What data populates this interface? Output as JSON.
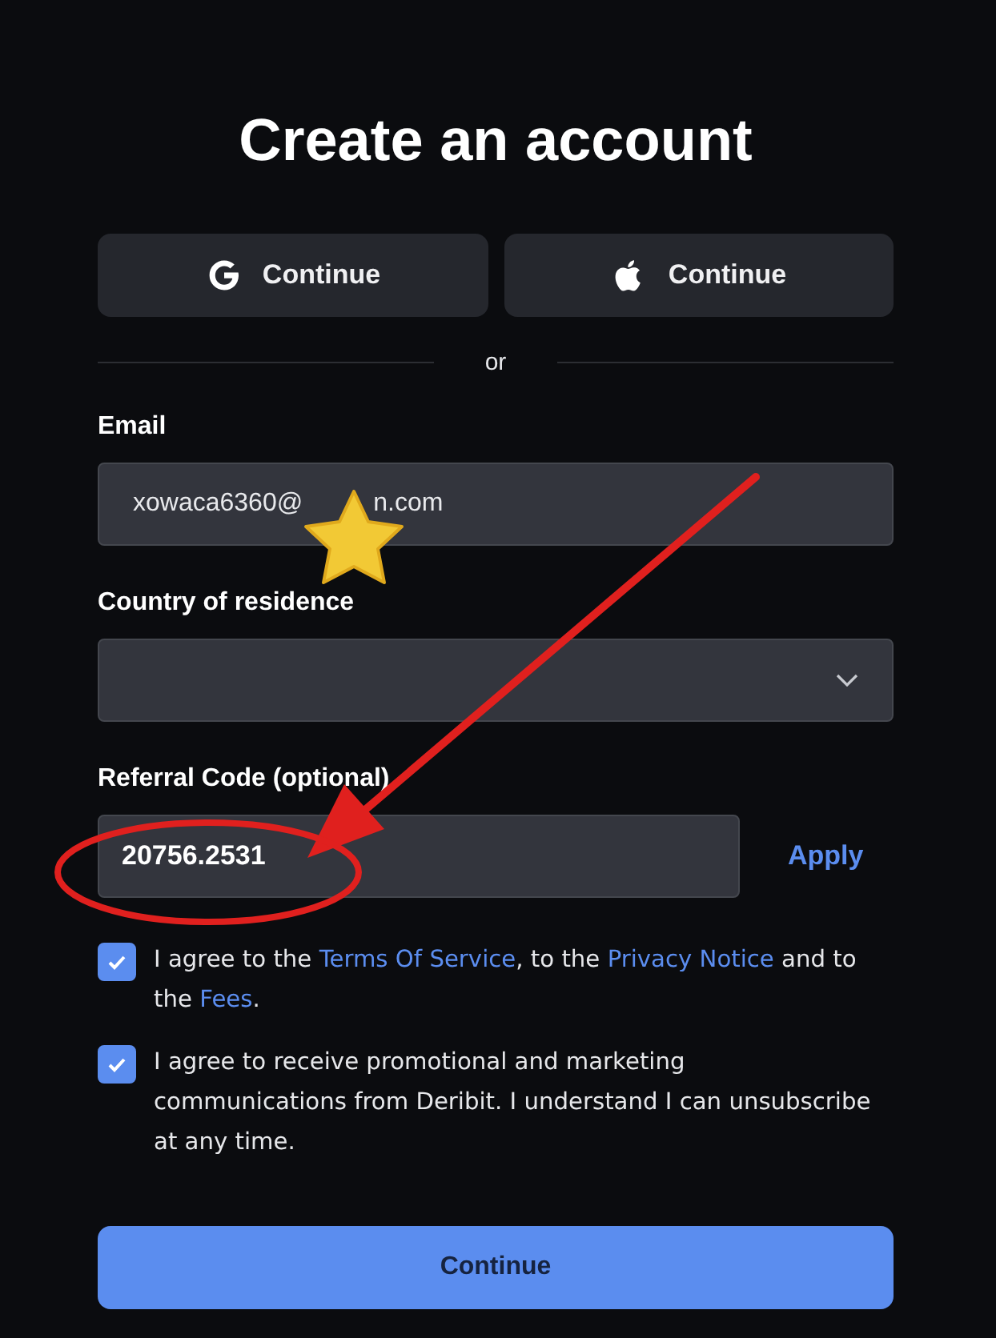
{
  "title": "Create an account",
  "social_buttons": [
    {
      "kind": "google",
      "label": "Continue"
    },
    {
      "kind": "apple",
      "label": "Continue"
    }
  ],
  "divider_text": "or",
  "email": {
    "label": "Email",
    "value_start": "xowaca6360@",
    "value_end": "n.com"
  },
  "country": {
    "label": "Country of residence"
  },
  "referral": {
    "label": "Referral Code (optional)",
    "value": "20756.2531",
    "apply": "Apply"
  },
  "agreements": [
    {
      "checked": true,
      "parts": [
        {
          "text": "I agree to the ",
          "link": false
        },
        {
          "text": "Terms Of Service",
          "link": true
        },
        {
          "text": ", to the ",
          "link": false
        },
        {
          "text": "Privacy Notice",
          "link": true
        },
        {
          "text": " and to the ",
          "link": false
        },
        {
          "text": "Fees",
          "link": true
        },
        {
          "text": ".",
          "link": false
        }
      ]
    },
    {
      "checked": true,
      "parts": [
        {
          "text": "I agree to receive promotional and marketing communications from Deribit. I understand I can unsubscribe at any time.",
          "link": false
        }
      ]
    }
  ],
  "submit": "Continue"
}
